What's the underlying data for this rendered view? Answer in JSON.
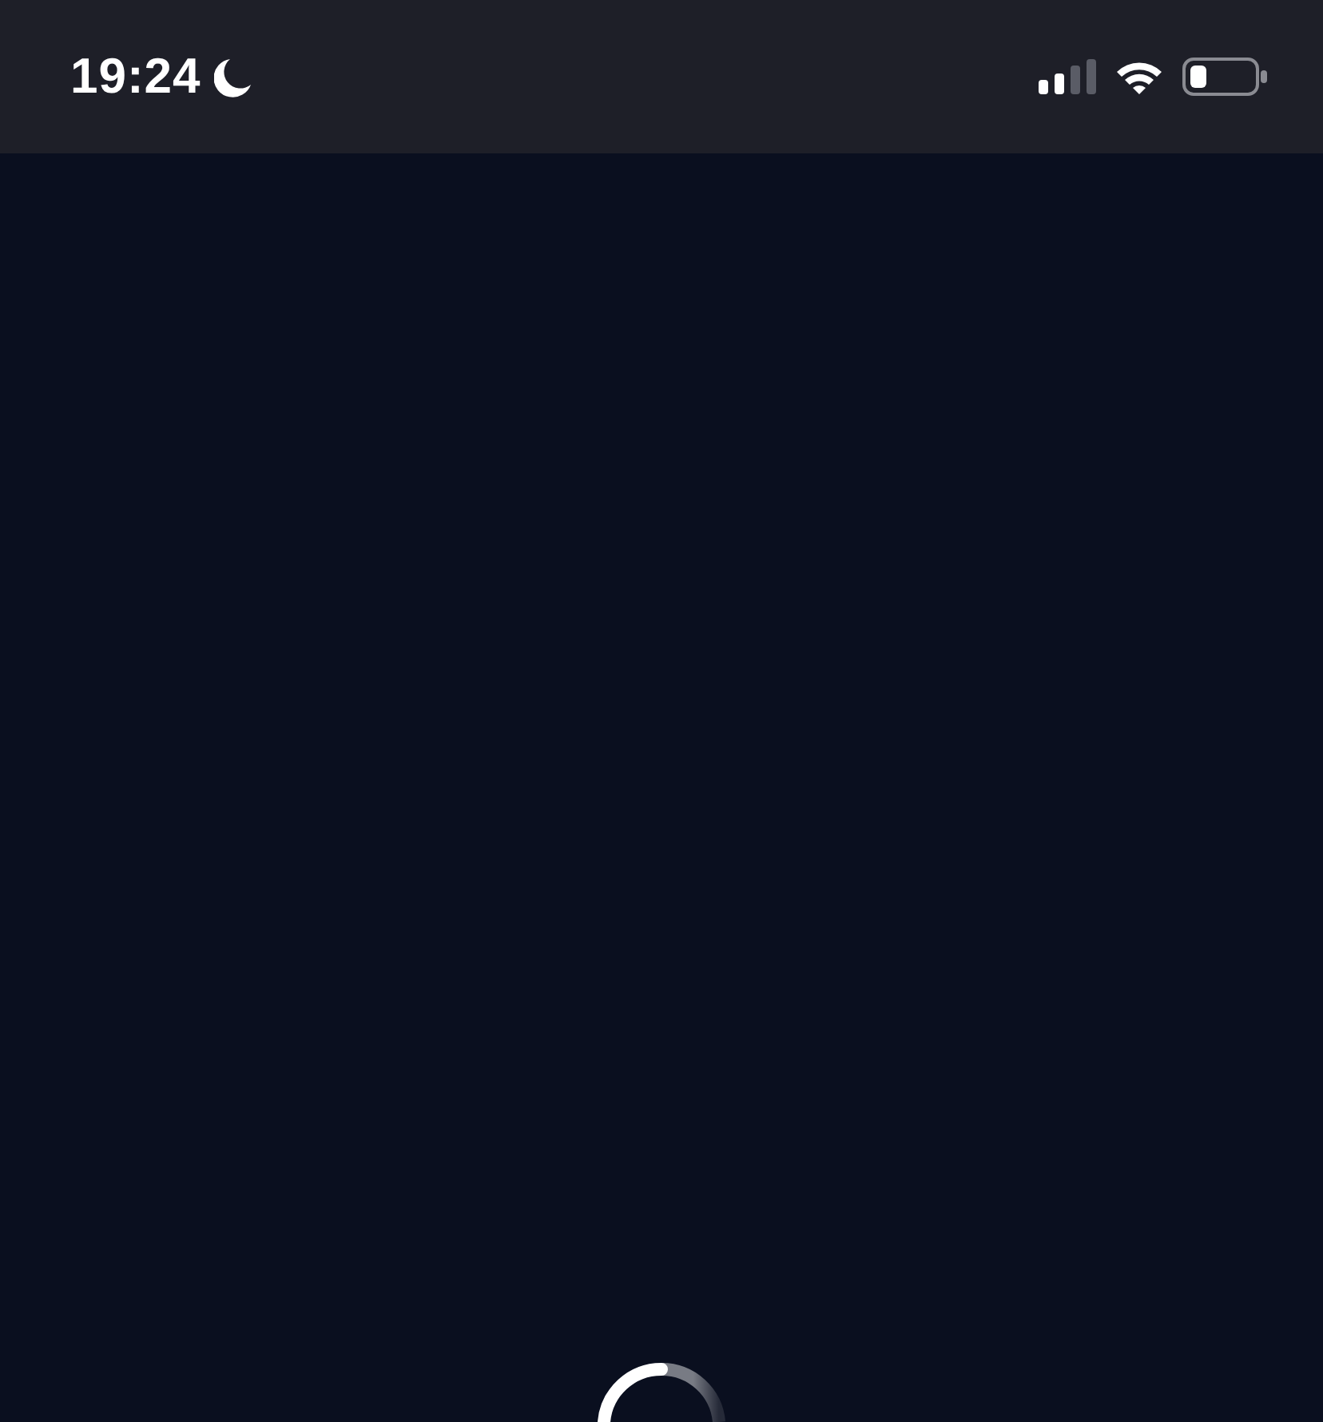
{
  "status_bar": {
    "time": "19:24",
    "do_not_disturb": true
  },
  "content": {
    "loading": true
  }
}
